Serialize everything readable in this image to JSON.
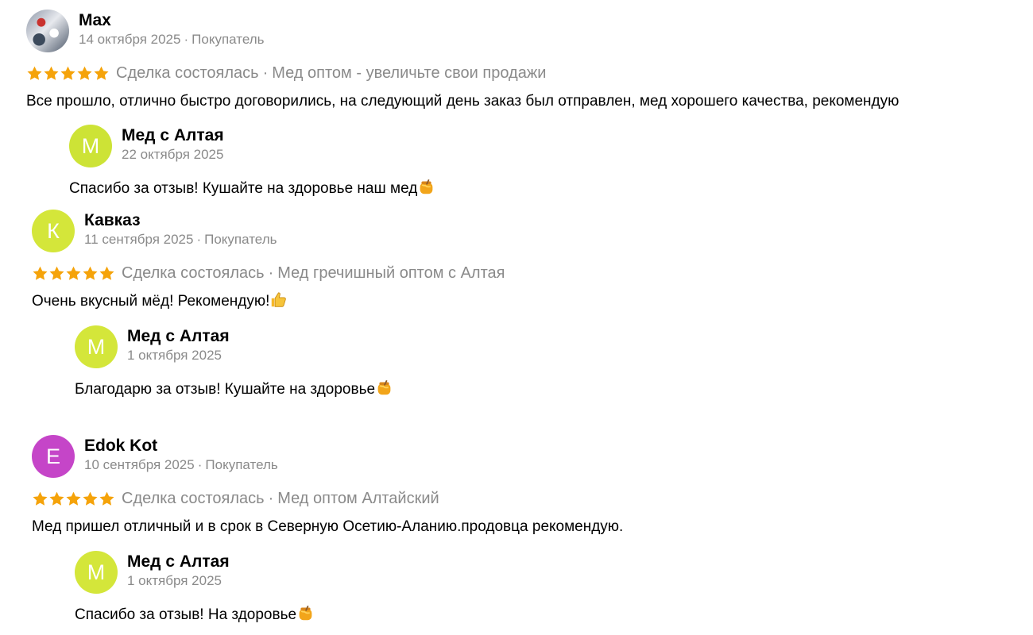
{
  "colors": {
    "star": "#f5a30a",
    "muted_text": "#8a8a8a",
    "avatar_green": "#cde336",
    "avatar_yellowgreen": "#d4e63a",
    "avatar_magenta": "#c545c8"
  },
  "reviews": [
    {
      "author": "Max",
      "avatar_type": "photo",
      "date": "14 октября 2025",
      "role": "Покупатель",
      "rating": 5,
      "status": "Сделка состоялась",
      "product": "Мед оптом - увеличьте свои продажи",
      "text": "Все прошло, отлично быстро договорились, на следующий день заказ был отправлен, мед хорошего качества, рекомендую",
      "reply": {
        "author": "Мед с Алтая",
        "avatar_letter": "М",
        "date": "22 октября 2025",
        "text": "Спасибо за отзыв! Кушайте на здоровье наш мед",
        "emoji": "honey-pot-icon"
      }
    },
    {
      "author": "Кавказ",
      "avatar_letter": "К",
      "date": "11 сентября 2025",
      "role": "Покупатель",
      "rating": 5,
      "status": "Сделка состоялась",
      "product": "Мед гречишный оптом с Алтая",
      "text": "Очень вкусный мёд! Рекомендую!",
      "emoji": "thumbs-up-icon",
      "reply": {
        "author": "Мед с Алтая",
        "avatar_letter": "М",
        "date": "1 октября 2025",
        "text": "Благодарю за отзыв! Кушайте на здоровье",
        "emoji": "honey-pot-icon"
      }
    },
    {
      "author": "Edok Kot",
      "avatar_letter": "E",
      "date": "10 сентября 2025",
      "role": "Покупатель",
      "rating": 5,
      "status": "Сделка состоялась",
      "product": "Мед оптом Алтайский",
      "text": "Мед пришел отличный и в срок в Северную Осетию-Аланию.продовца рекомендую.",
      "reply": {
        "author": "Мед с Алтая",
        "avatar_letter": "М",
        "date": "1 октября 2025",
        "text": "Спасибо за отзыв! На здоровье",
        "emoji": "honey-pot-icon"
      }
    }
  ]
}
